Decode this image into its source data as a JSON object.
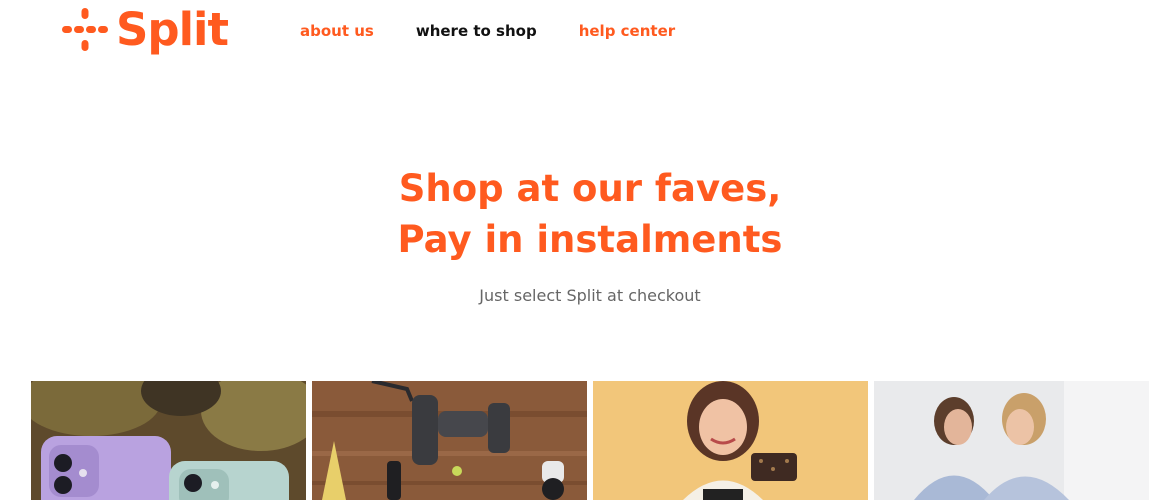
{
  "brand": {
    "name": "Split",
    "accent": "#ff5a1f"
  },
  "nav": {
    "items": [
      {
        "label": "about us"
      },
      {
        "label": "where to shop"
      },
      {
        "label": "help center"
      }
    ]
  },
  "hero": {
    "title_line1": "Shop at our faves,",
    "title_line2": "Pay in instalments",
    "subtitle": "Just select Split at checkout"
  },
  "tiles": [
    {
      "icon": "phones-photo"
    },
    {
      "icon": "camera-gear-photo"
    },
    {
      "icon": "woman-wallet-photo"
    },
    {
      "icon": "friends-photo"
    }
  ]
}
